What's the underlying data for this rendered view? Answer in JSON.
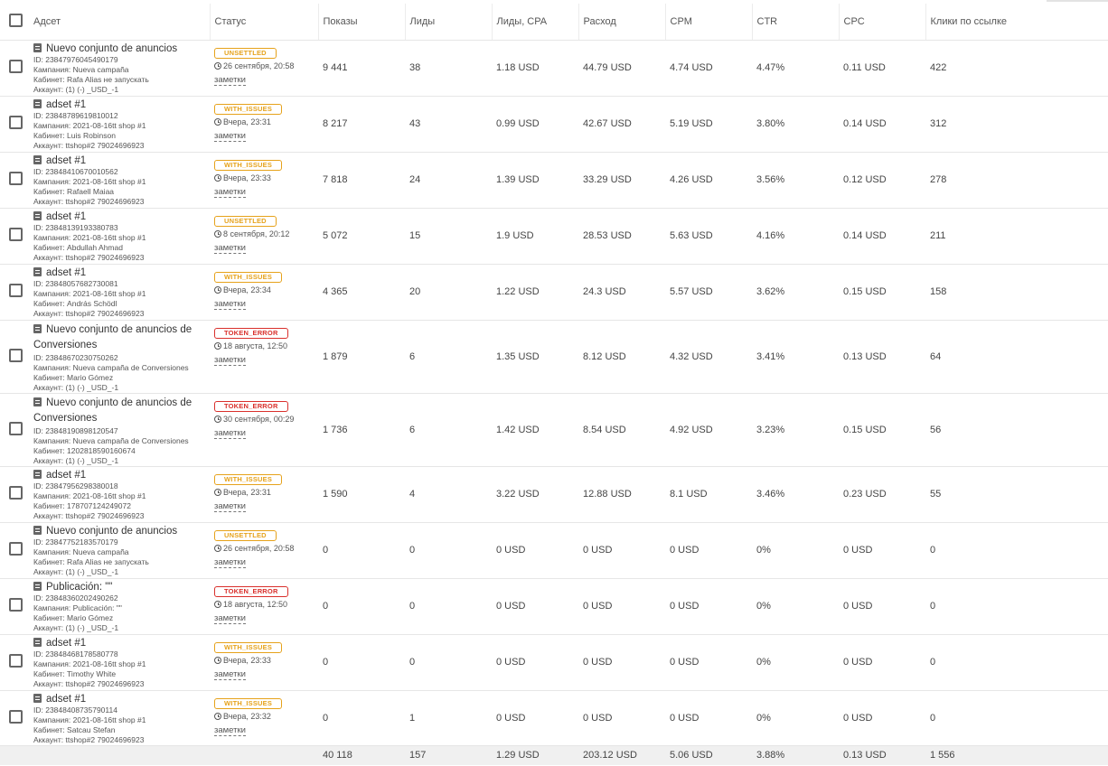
{
  "header": {
    "adset": "Адсет",
    "status": "Статус",
    "impressions": "Показы",
    "leads": "Лиды",
    "cpa": "Лиды, CPA",
    "spend": "Расход",
    "cpm": "CPM",
    "ctr": "CTR",
    "cpc": "CPC",
    "link_clicks": "Клики по ссылке"
  },
  "rows": [
    {
      "title": "Nuevo conjunto de anuncios",
      "id": "ID: 23847976045490179",
      "campaign": "Кампания: Nueva campaña",
      "cabinet": "Кабинет: Rafa Alias не запускать",
      "account": "Аккаунт: (1) (-) _USD_-1",
      "badge": "UNSETTLED",
      "badge_type": "warn",
      "time": "26 сентября, 20:58",
      "notes": "заметки",
      "impressions": "9 441",
      "leads": "38",
      "cpa": "1.18 USD",
      "spend": "44.79 USD",
      "cpm": "4.74 USD",
      "ctr": "4.47%",
      "cpc": "0.11 USD",
      "clicks": "422"
    },
    {
      "title": "adset #1",
      "id": "ID: 23848789619810012",
      "campaign": "Кампания: 2021-08-16tt shop #1",
      "cabinet": "Кабинет: Luis Robinson",
      "account": "Аккаунт: ttshop#2 79024696923",
      "badge": "WITH_ISSUES",
      "badge_type": "warn",
      "time": "Вчера, 23:31",
      "notes": "заметки",
      "impressions": "8 217",
      "leads": "43",
      "cpa": "0.99 USD",
      "spend": "42.67 USD",
      "cpm": "5.19 USD",
      "ctr": "3.80%",
      "cpc": "0.14 USD",
      "clicks": "312"
    },
    {
      "title": "adset #1",
      "id": "ID: 23848410670010562",
      "campaign": "Кампания: 2021-08-16tt shop #1",
      "cabinet": "Кабинет: Rafaell Maiaa",
      "account": "Аккаунт: ttshop#2 79024696923",
      "badge": "WITH_ISSUES",
      "badge_type": "warn",
      "time": "Вчера, 23:33",
      "notes": "заметки",
      "impressions": "7 818",
      "leads": "24",
      "cpa": "1.39 USD",
      "spend": "33.29 USD",
      "cpm": "4.26 USD",
      "ctr": "3.56%",
      "cpc": "0.12 USD",
      "clicks": "278"
    },
    {
      "title": "adset #1",
      "id": "ID: 23848139193380783",
      "campaign": "Кампания: 2021-08-16tt shop #1",
      "cabinet": "Кабинет: Abdullah Ahmad",
      "account": "Аккаунт: ttshop#2 79024696923",
      "badge": "UNSETTLED",
      "badge_type": "warn",
      "time": "8 сентября, 20:12",
      "notes": "заметки",
      "impressions": "5 072",
      "leads": "15",
      "cpa": "1.9 USD",
      "spend": "28.53 USD",
      "cpm": "5.63 USD",
      "ctr": "4.16%",
      "cpc": "0.14 USD",
      "clicks": "211"
    },
    {
      "title": "adset #1",
      "id": "ID: 23848057682730081",
      "campaign": "Кампания: 2021-08-16tt shop #1",
      "cabinet": "Кабинет: András Schödl",
      "account": "Аккаунт: ttshop#2 79024696923",
      "badge": "WITH_ISSUES",
      "badge_type": "warn",
      "time": "Вчера, 23:34",
      "notes": "заметки",
      "impressions": "4 365",
      "leads": "20",
      "cpa": "1.22 USD",
      "spend": "24.3 USD",
      "cpm": "5.57 USD",
      "ctr": "3.62%",
      "cpc": "0.15 USD",
      "clicks": "158"
    },
    {
      "title": "Nuevo conjunto de anuncios de Conversiones",
      "id": "ID: 23848670230750262",
      "campaign": "Кампания: Nueva campaña de Conversiones",
      "cabinet": "Кабинет: Mario Gómez",
      "account": "Аккаунт: (1) (-) _USD_-1",
      "badge": "TOKEN_ERROR",
      "badge_type": "err",
      "time": "18 августа, 12:50",
      "notes": "заметки",
      "impressions": "1 879",
      "leads": "6",
      "cpa": "1.35 USD",
      "spend": "8.12 USD",
      "cpm": "4.32 USD",
      "ctr": "3.41%",
      "cpc": "0.13 USD",
      "clicks": "64"
    },
    {
      "title": "Nuevo conjunto de anuncios de Conversiones",
      "id": "ID: 23848190898120547",
      "campaign": "Кампания: Nueva campaña de Conversiones",
      "cabinet": "Кабинет: 1202818590160674",
      "account": "Аккаунт: (1) (-) _USD_-1",
      "badge": "TOKEN_ERROR",
      "badge_type": "err",
      "time": "30 сентября, 00:29",
      "notes": "заметки",
      "impressions": "1 736",
      "leads": "6",
      "cpa": "1.42 USD",
      "spend": "8.54 USD",
      "cpm": "4.92 USD",
      "ctr": "3.23%",
      "cpc": "0.15 USD",
      "clicks": "56"
    },
    {
      "title": "adset #1",
      "id": "ID: 23847956298380018",
      "campaign": "Кампания: 2021-08-16tt shop #1",
      "cabinet": "Кабинет: 178707124249072",
      "account": "Аккаунт: ttshop#2 79024696923",
      "badge": "WITH_ISSUES",
      "badge_type": "warn",
      "time": "Вчера, 23:31",
      "notes": "заметки",
      "impressions": "1 590",
      "leads": "4",
      "cpa": "3.22 USD",
      "spend": "12.88 USD",
      "cpm": "8.1 USD",
      "ctr": "3.46%",
      "cpc": "0.23 USD",
      "clicks": "55"
    },
    {
      "title": "Nuevo conjunto de anuncios",
      "id": "ID: 23847752183570179",
      "campaign": "Кампания: Nueva campaña",
      "cabinet": "Кабинет: Rafa Alias не запускать",
      "account": "Аккаунт: (1) (-) _USD_-1",
      "badge": "UNSETTLED",
      "badge_type": "warn",
      "time": "26 сентября, 20:58",
      "notes": "заметки",
      "impressions": "0",
      "leads": "0",
      "cpa": "0 USD",
      "spend": "0 USD",
      "cpm": "0 USD",
      "ctr": "0%",
      "cpc": "0 USD",
      "clicks": "0"
    },
    {
      "title": "Publicación: \"\"",
      "id": "ID: 23848360202490262",
      "campaign": "Кампания: Publicación: \"\"",
      "cabinet": "Кабинет: Mario Gómez",
      "account": "Аккаунт: (1) (-) _USD_-1",
      "badge": "TOKEN_ERROR",
      "badge_type": "err",
      "time": "18 августа, 12:50",
      "notes": "заметки",
      "impressions": "0",
      "leads": "0",
      "cpa": "0 USD",
      "spend": "0 USD",
      "cpm": "0 USD",
      "ctr": "0%",
      "cpc": "0 USD",
      "clicks": "0"
    },
    {
      "title": "adset #1",
      "id": "ID: 23848468178580778",
      "campaign": "Кампания: 2021-08-16tt shop #1",
      "cabinet": "Кабинет: Timothy White",
      "account": "Аккаунт: ttshop#2 79024696923",
      "badge": "WITH_ISSUES",
      "badge_type": "warn",
      "time": "Вчера, 23:33",
      "notes": "заметки",
      "impressions": "0",
      "leads": "0",
      "cpa": "0 USD",
      "spend": "0 USD",
      "cpm": "0 USD",
      "ctr": "0%",
      "cpc": "0 USD",
      "clicks": "0"
    },
    {
      "title": "adset #1",
      "id": "ID: 23848408735790114",
      "campaign": "Кампания: 2021-08-16tt shop #1",
      "cabinet": "Кабинет: Satcau Stefan",
      "account": "Аккаунт: ttshop#2 79024696923",
      "badge": "WITH_ISSUES",
      "badge_type": "warn",
      "time": "Вчера, 23:32",
      "notes": "заметки",
      "impressions": "0",
      "leads": "1",
      "cpa": "0 USD",
      "spend": "0 USD",
      "cpm": "0 USD",
      "ctr": "0%",
      "cpc": "0 USD",
      "clicks": "0"
    }
  ],
  "totals": {
    "impressions": "40 118",
    "leads": "157",
    "cpa": "1.29 USD",
    "spend": "203.12 USD",
    "cpm": "5.06 USD",
    "ctr": "3.88%",
    "cpc": "0.13 USD",
    "clicks": "1 556"
  },
  "colors": {
    "badge_warn": "#e6a21b",
    "badge_error": "#d9302c",
    "totals_background": "#f0f0f0",
    "row_border": "#e6e6e6"
  },
  "icons": {
    "row_title": "document-icon",
    "status_time": "clock-icon",
    "select": "checkbox"
  }
}
